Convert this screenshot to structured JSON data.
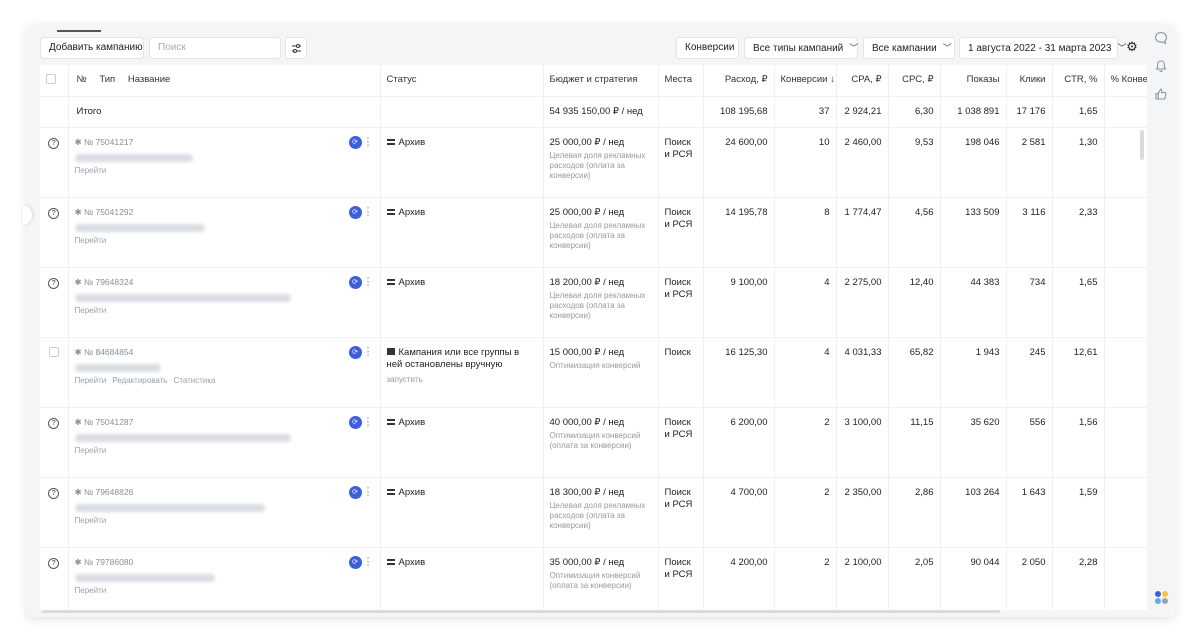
{
  "toolbar": {
    "add_campaign": "Добавить кампанию",
    "search_placeholder": "Поиск",
    "conversions": "Конверсии",
    "campaign_types": "Все типы кампаний",
    "campaigns": "Все кампании",
    "date_range": "1 августа 2022 - 31 марта 2023"
  },
  "columns": [
    "№",
    "Тип",
    "Название",
    "Статус",
    "Бюджет и стратегия",
    "Места",
    "Расход, ₽",
    "Конверсии ↓",
    "CPA, ₽",
    "CPC, ₽",
    "Показы",
    "Клики",
    "CTR, %",
    "% Конве"
  ],
  "total": {
    "label": "Итого",
    "budget": "54 935 150,00 ₽ / нед",
    "spend": "108 195,68",
    "conversions": "37",
    "cpa": "2 924,21",
    "cpc": "6,30",
    "impressions": "1 038 891",
    "clicks": "17 176",
    "ctr": "1,65"
  },
  "rows": [
    {
      "id": "№ 75041217",
      "links": [
        "Перейти"
      ],
      "status": "Архив",
      "status_type": "archive",
      "status_sub": "",
      "budget": "25 000,00 ₽ / нед",
      "strategy": "Целевая доля рекламных расходов (оплата за конверсии)",
      "places": "Поиск и РСЯ",
      "spend": "24 600,00",
      "conversions": "10",
      "cpa": "2 460,00",
      "cpc": "9,53",
      "impressions": "198 046",
      "clicks": "2 581",
      "ctr": "1,30",
      "lead": "help"
    },
    {
      "id": "№ 75041292",
      "links": [
        "Перейти"
      ],
      "status": "Архив",
      "status_type": "archive",
      "status_sub": "",
      "budget": "25 000,00 ₽ / нед",
      "strategy": "Целевая доля рекламных расходов (оплата за конверсии)",
      "places": "Поиск и РСЯ",
      "spend": "14 195,78",
      "conversions": "8",
      "cpa": "1 774,47",
      "cpc": "4,56",
      "impressions": "133 509",
      "clicks": "3 116",
      "ctr": "2,33",
      "lead": "help"
    },
    {
      "id": "№ 79648324",
      "links": [
        "Перейти"
      ],
      "status": "Архив",
      "status_type": "archive",
      "status_sub": "",
      "budget": "18 200,00 ₽ / нед",
      "strategy": "Целевая доля рекламных расходов (оплата за конверсии)",
      "places": "Поиск и РСЯ",
      "spend": "9 100,00",
      "conversions": "4",
      "cpa": "2 275,00",
      "cpc": "12,40",
      "impressions": "44 383",
      "clicks": "734",
      "ctr": "1,65",
      "lead": "help"
    },
    {
      "id": "№ 84684854",
      "links": [
        "Перейти",
        "Редактировать",
        "Статистика"
      ],
      "status": "Кампания или все группы в ней остановлены вручную",
      "status_type": "stop",
      "status_sub": "запустить",
      "budget": "15 000,00 ₽ / нед",
      "strategy": "Оптимизация конверсий",
      "places": "Поиск",
      "spend": "16 125,30",
      "conversions": "4",
      "cpa": "4 031,33",
      "cpc": "65,82",
      "impressions": "1 943",
      "clicks": "245",
      "ctr": "12,61",
      "lead": "checkbox"
    },
    {
      "id": "№ 75041287",
      "links": [
        "Перейти"
      ],
      "status": "Архив",
      "status_type": "archive",
      "status_sub": "",
      "budget": "40 000,00 ₽ / нед",
      "strategy": "Оптимизация конверсий (оплата за конверсии)",
      "places": "Поиск и РСЯ",
      "spend": "6 200,00",
      "conversions": "2",
      "cpa": "3 100,00",
      "cpc": "11,15",
      "impressions": "35 620",
      "clicks": "556",
      "ctr": "1,56",
      "lead": "help"
    },
    {
      "id": "№ 79648826",
      "links": [
        "Перейти"
      ],
      "status": "Архив",
      "status_type": "archive",
      "status_sub": "",
      "budget": "18 300,00 ₽ / нед",
      "strategy": "Целевая доля рекламных расходов (оплата за конверсии)",
      "places": "Поиск и РСЯ",
      "spend": "4 700,00",
      "conversions": "2",
      "cpa": "2 350,00",
      "cpc": "2,86",
      "impressions": "103 264",
      "clicks": "1 643",
      "ctr": "1,59",
      "lead": "help"
    },
    {
      "id": "№ 79786080",
      "links": [
        "Перейти"
      ],
      "status": "Архив",
      "status_type": "archive",
      "status_sub": "",
      "budget": "35 000,00 ₽ / нед",
      "strategy": "Оптимизация конверсий (оплата за конверсии)",
      "places": "Поиск и РСЯ",
      "spend": "4 200,00",
      "conversions": "2",
      "cpa": "2 100,00",
      "cpc": "2,05",
      "impressions": "90 044",
      "clicks": "2 050",
      "ctr": "2,28",
      "lead": "help"
    }
  ],
  "icons": {
    "filter": "sliders-icon",
    "settings": "gear-icon",
    "chat": "chat-icon",
    "bell": "bell-icon",
    "like": "thumbs-up-icon",
    "apps": "apps-icon"
  },
  "colors": {
    "accent": "#3d5ed9",
    "background": "#f4f5f7"
  }
}
